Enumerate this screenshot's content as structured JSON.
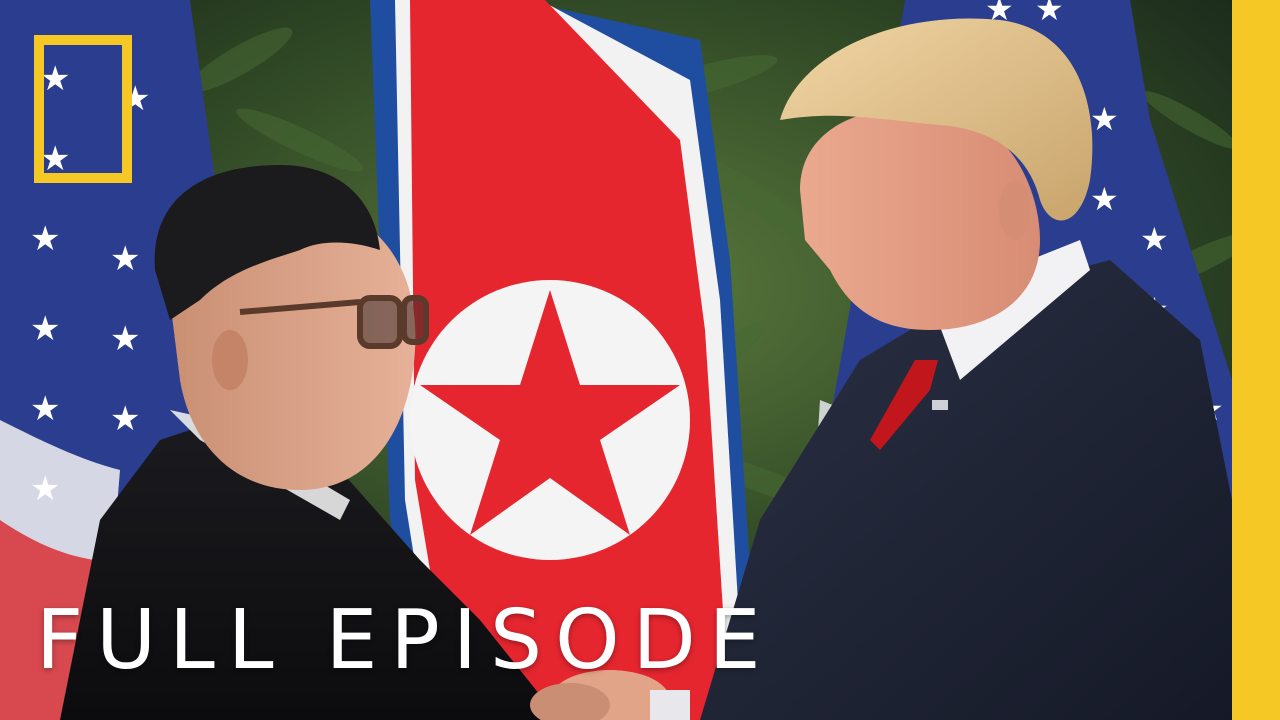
{
  "caption": {
    "text": "FULL EPISODE"
  },
  "brand": {
    "logo": "national-geographic-yellow-rectangle",
    "accent_color": "#f6c826"
  },
  "colors": {
    "us_flag_blue": "#2b3d8f",
    "dprk_flag_red": "#e5262f",
    "dprk_flag_blue": "#1f4ea0",
    "foliage": "#2f4a24",
    "caption": "#ffffff"
  }
}
